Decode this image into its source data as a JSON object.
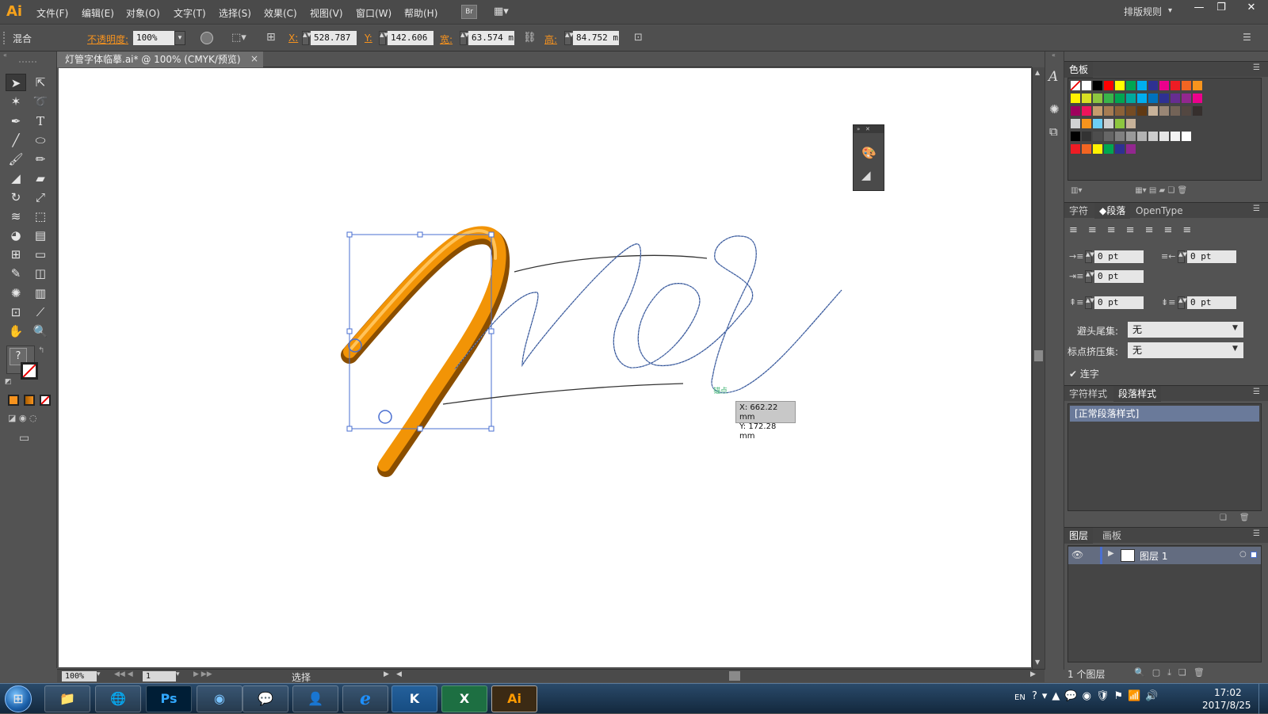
{
  "app": {
    "logo": "Ai"
  },
  "menu": [
    "文件(F)",
    "编辑(E)",
    "对象(O)",
    "文字(T)",
    "选择(S)",
    "效果(C)",
    "视图(V)",
    "窗口(W)",
    "帮助(H)"
  ],
  "menu_extra": {
    "br": "Br",
    "workspace": "排版规则"
  },
  "window_buttons": [
    "—",
    "❐",
    "✕"
  ],
  "control_bar": {
    "object_type": "混合",
    "opacity_label": "不透明度:",
    "opacity_value": "100%",
    "x_label": "X:",
    "x_value": "528.787 ı",
    "y_label": "Y:",
    "y_value": "142.606 ı",
    "w_label": "宽:",
    "w_value": "63.574 mı",
    "h_label": "高:",
    "h_value": "84.752 mı"
  },
  "document_tab": {
    "title": "灯管字体临摹.ai* @ 100% (CMYK/预览)",
    "close": "×"
  },
  "tooltip": {
    "x": "X: 662.22 mm",
    "y": "Y: 172.28 mm",
    "anchor_label": "锚点"
  },
  "status_bar": {
    "zoom": "100%",
    "artboard": "1",
    "tool": "选择"
  },
  "panels": {
    "swatches": {
      "tab": "色板"
    },
    "character": {
      "tabs": [
        "字符",
        "段落",
        "OpenType"
      ],
      "active": "段落"
    },
    "paragraph": {
      "left_indent": "0 pt",
      "right_indent": "0 pt",
      "first_indent": "0 pt",
      "space_before": "0 pt",
      "space_after": "0 pt",
      "kinsoku_label": "避头尾集:",
      "kinsoku_value": "无",
      "mojikumi_label": "标点挤压集:",
      "mojikumi_value": "无",
      "hyphen_label": "连字"
    },
    "styles": {
      "tabs": [
        "字符样式",
        "段落样式"
      ],
      "active": "段落样式",
      "items": [
        "[正常段落样式]"
      ]
    },
    "layers": {
      "tabs": [
        "图层",
        "画板"
      ],
      "active": "图层",
      "items": [
        {
          "name": "图层 1"
        }
      ],
      "footer": "1 个图层"
    }
  },
  "colors": {
    "accent": "#f7931e",
    "selection": "#4a6fd1",
    "path": "#2a4a8a"
  },
  "swatch_rows": [
    [
      "#ffffff",
      "#ffffff",
      "#000000",
      "#ff0000",
      "#ffff00",
      "#00a651",
      "#00aeef",
      "#2e3192",
      "#ec008c",
      "#ed1c24",
      "#f26522",
      "#f7941d"
    ],
    [
      "#fff200",
      "#d7df23",
      "#8dc63f",
      "#39b54a",
      "#00a651",
      "#00a99d",
      "#00aeef",
      "#0072bc",
      "#2e3192",
      "#662d91",
      "#92278f",
      "#ec008c"
    ],
    [
      "#9e005d",
      "#ed145b",
      "#c69c6d",
      "#a67c52",
      "#8c6239",
      "#754c24",
      "#603913",
      "#c7b299",
      "#998675",
      "#736357",
      "#534741",
      "#362f2d"
    ],
    [
      "#d1d3d4",
      "#f7941d",
      "#6dcff6",
      "#cfcfcf",
      "#8dc63f",
      "#c7b299"
    ],
    [
      "#000000",
      "#333333",
      "#4d4d4d",
      "#666666",
      "#808080",
      "#999999",
      "#b3b3b3",
      "#cccccc",
      "#e6e6e6",
      "#f2f2f2",
      "#ffffff"
    ],
    [
      "#ed1c24",
      "#f26522",
      "#fff200",
      "#00a651",
      "#2e3192",
      "#92278f"
    ]
  ],
  "taskbar": {
    "apps": [
      "📁",
      "🌐",
      "Ps",
      "◉",
      "💬",
      "👤",
      "e",
      "K",
      "X",
      "Ai"
    ],
    "lang": "EN",
    "time": "17:02",
    "date": "2017/8/25"
  }
}
